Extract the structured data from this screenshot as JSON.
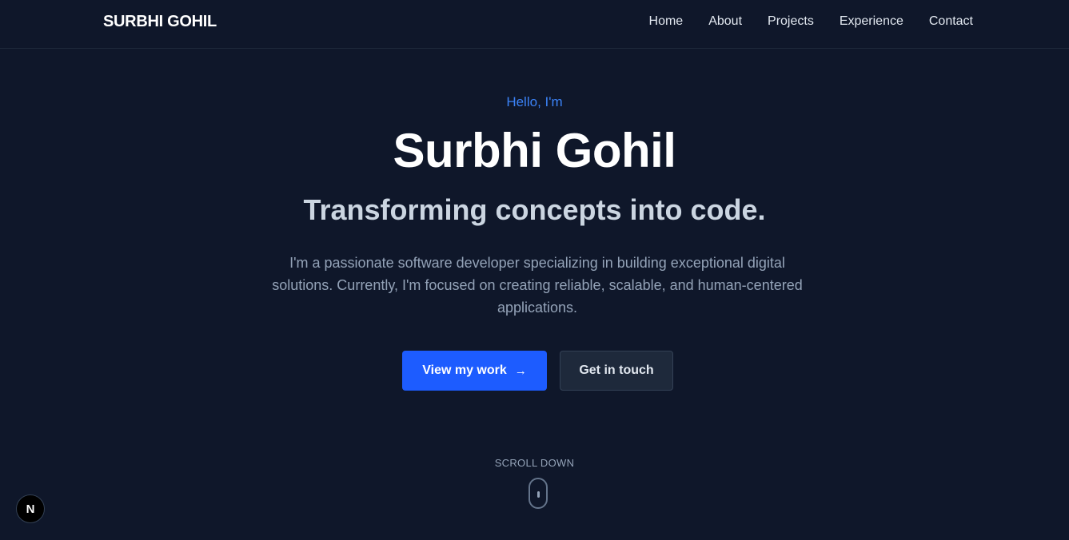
{
  "header": {
    "brand": "SURBHI GOHIL",
    "nav": [
      {
        "label": "Home"
      },
      {
        "label": "About"
      },
      {
        "label": "Projects"
      },
      {
        "label": "Experience"
      },
      {
        "label": "Contact"
      }
    ]
  },
  "hero": {
    "greeting": "Hello, I'm",
    "name": "Surbhi Gohil",
    "tagline": "Transforming concepts into code.",
    "intro": "I'm a passionate software developer specializing in building exceptional digital solutions. Currently, I'm focused on creating reliable, scalable, and human-centered applications.",
    "primary_button": "View my work",
    "primary_button_icon": "arrow-right-icon",
    "secondary_button": "Get in touch",
    "scroll_label": "SCROLL DOWN"
  },
  "dev_badge": {
    "letter": "N"
  },
  "colors": {
    "background": "#0f172a",
    "accent": "#3b82f6",
    "primary_button": "#1d5cff"
  }
}
